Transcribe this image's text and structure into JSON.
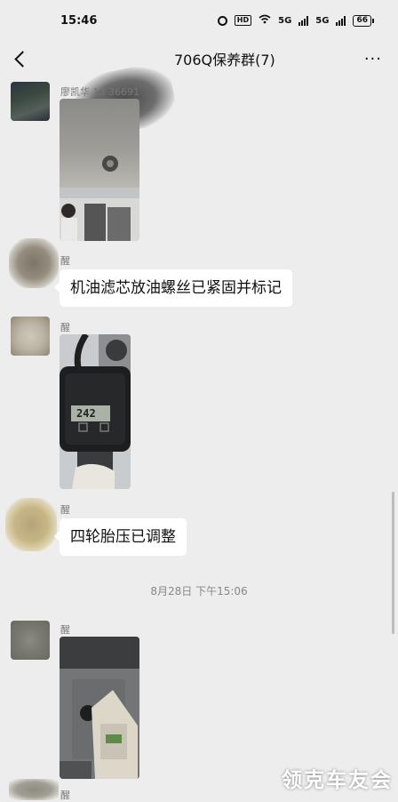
{
  "status_bar": {
    "time": "15:46",
    "hd": "HD",
    "signal1": "5G",
    "signal2": "5G",
    "battery": "66"
  },
  "header": {
    "title": "706Q保养群(7)",
    "more": "···"
  },
  "messages": [
    {
      "sender": "廖凯华 13 36691"
    },
    {
      "sender": "醒",
      "text": "机油滤芯放油螺丝已紧固并标记"
    },
    {
      "sender": "醒"
    },
    {
      "sender": "醒",
      "text": "四轮胎压已调整"
    },
    {
      "sender": "醒"
    },
    {
      "sender": "醒"
    }
  ],
  "gauge": {
    "display": "242"
  },
  "timestamp": "8月28日 下午15:06",
  "watermark": "领克车友会"
}
